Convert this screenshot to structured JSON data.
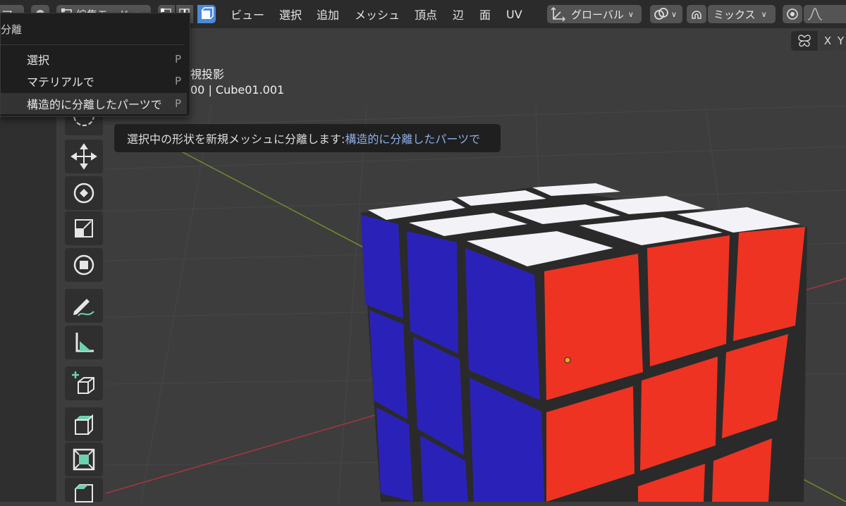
{
  "header": {
    "left_cut": "ア",
    "mode_label": "編集モード",
    "menu_view": "ビュー",
    "menu_select": "選択",
    "menu_add": "追加",
    "menu_mesh": "メッシュ",
    "menu_vertex": "頂点",
    "menu_edge": "辺",
    "menu_face": "面",
    "menu_uv": "UV",
    "orientation": "グローバル",
    "snap_mode": "ミックス"
  },
  "viewport_overlay": {
    "projection": "視投影",
    "object_info": "00 | Cube01.001"
  },
  "separate_menu": {
    "title": "分離",
    "items": [
      {
        "label": "選択",
        "shortcut": "P"
      },
      {
        "label": "マテリアルで",
        "shortcut": "P"
      },
      {
        "label": "構造的に分離したパーツで",
        "shortcut": "P"
      }
    ]
  },
  "tooltip": {
    "text": "選択中の形状を新規メッシュに分離します: ",
    "highlight": "構造的に分離したパーツで"
  },
  "axis_buttons": {
    "x": "X",
    "y": "Y"
  },
  "colors": {
    "header_bg": "#2b2b2b",
    "viewport_bg": "#3d3d3d",
    "cube_white": "#f2f2f7",
    "cube_blue": "#2a22b8",
    "cube_red": "#ee3322",
    "cube_edge": "#2a2a2a",
    "accent_blue": "#4a8ad8",
    "tooltip_highlight": "#8fb0e8"
  }
}
